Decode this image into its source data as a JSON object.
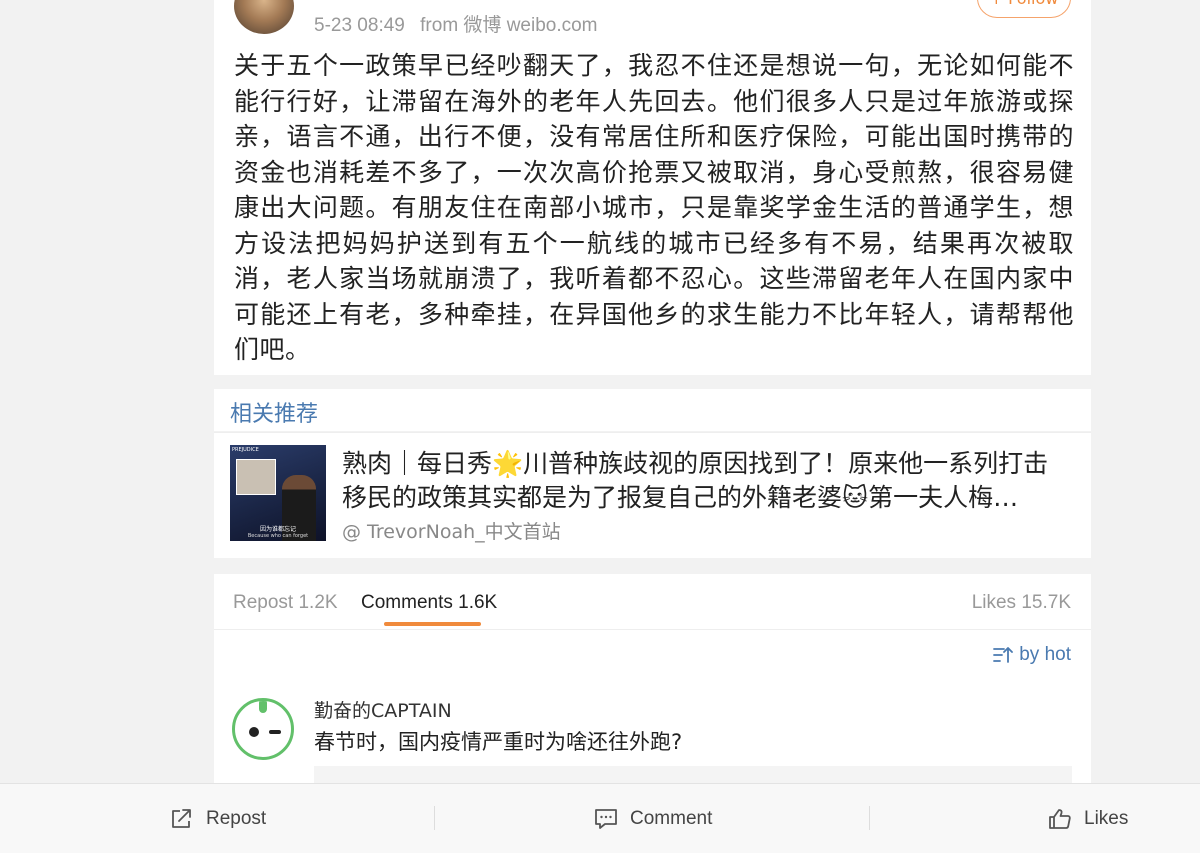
{
  "post": {
    "meta_time": "5-23 08:49",
    "meta_source": "from 微博 weibo.com",
    "follow_label": "+ Follow",
    "text": "关于五个一政策早已经吵翻天了，我忍不住还是想说一句，无论如何能不能行行好，让滞留在海外的老年人先回去。他们很多人只是过年旅游或探亲，语言不通，出行不便，没有常居住所和医疗保险，可能出国时携带的资金也消耗差不多了，一次次高价抢票又被取消，身心受煎熬，很容易健康出大问题。有朋友住在南部小城市，只是靠奖学金生活的普通学生，想方设法把妈妈护送到有五个一航线的城市已经多有不易，结果再次被取消，老人家当场就崩溃了，我听着都不忍心。这些滞留老年人在国内家中可能还上有老，多种牵挂，在异国他乡的求生能力不比年轻人，请帮帮他们吧。"
  },
  "related": {
    "title": "相关推荐",
    "item_text": "熟肉｜每日秀🌟川普种族歧视的原因找到了！原来他一系列打击移民的政策其实都是为了报复自己的外籍老婆🐱第一夫人梅…",
    "author": "@ TrevorNoah_中文首站",
    "thumb_caption": "因为谁都忘记",
    "thumb_caption_en": "Because who can forget",
    "thumb_badge": "PREJUDICE"
  },
  "tabs": {
    "repost": "Repost 1.2K",
    "comments": "Comments 1.6K",
    "likes": "Likes 15.7K",
    "sort": "by hot"
  },
  "comment": {
    "name": "勤奋的CAPTAIN",
    "text": "春节时，国内疫情严重时为啥还往外跑?"
  },
  "bottom_bar": {
    "repost": "Repost",
    "comment": "Comment",
    "likes": "Likes"
  },
  "colors": {
    "accent": "#f08a3c",
    "link": "#4a7ab0"
  }
}
